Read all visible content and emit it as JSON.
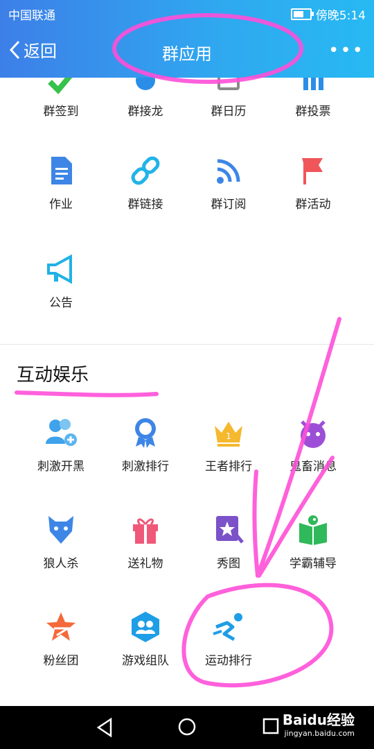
{
  "status": {
    "carrier": "中国联通",
    "time": "傍晚5:14"
  },
  "nav": {
    "back": "返回",
    "title": "群应用",
    "more": "•••"
  },
  "apps_row1": [
    {
      "label": "群签到",
      "icon": "checkin-icon"
    },
    {
      "label": "群接龙",
      "icon": "relay-icon"
    },
    {
      "label": "群日历",
      "icon": "calendar-icon"
    },
    {
      "label": "群投票",
      "icon": "vote-icon"
    }
  ],
  "apps_row2": [
    {
      "label": "作业",
      "icon": "homework-icon"
    },
    {
      "label": "群链接",
      "icon": "link-icon"
    },
    {
      "label": "群订阅",
      "icon": "rss-icon"
    },
    {
      "label": "群活动",
      "icon": "flag-icon"
    }
  ],
  "apps_row3": [
    {
      "label": "公告",
      "icon": "megaphone-icon"
    }
  ],
  "section": {
    "title": "互动娱乐"
  },
  "ent_row1": [
    {
      "label": "刺激开黑",
      "icon": "team-up-icon"
    },
    {
      "label": "刺激排行",
      "icon": "medal-icon"
    },
    {
      "label": "王者排行",
      "icon": "crown-icon"
    },
    {
      "label": "鬼畜消息",
      "icon": "devil-icon"
    }
  ],
  "ent_row2": [
    {
      "label": "狼人杀",
      "icon": "wolf-icon"
    },
    {
      "label": "送礼物",
      "icon": "gift-icon"
    },
    {
      "label": "秀图",
      "icon": "show-image-icon"
    },
    {
      "label": "学霸辅导",
      "icon": "study-book-icon"
    }
  ],
  "ent_row3": [
    {
      "label": "粉丝团",
      "icon": "fan-star-icon"
    },
    {
      "label": "游戏组队",
      "icon": "game-team-icon"
    },
    {
      "label": "运动排行",
      "icon": "sport-runner-icon"
    }
  ],
  "watermark": {
    "brand": "Baidu经验",
    "url": "jingyan.baidu.com"
  },
  "colors": {
    "nav_start": "#3d7fe8",
    "nav_end": "#27b9f2",
    "annotation": "#ff4fd8"
  }
}
